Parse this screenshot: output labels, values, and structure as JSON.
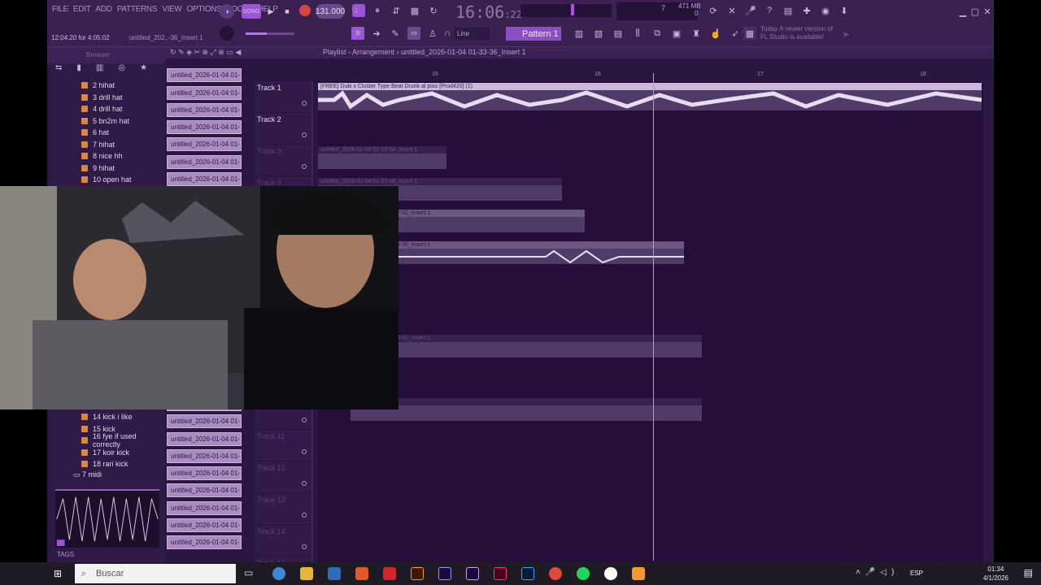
{
  "menu": [
    "FILE",
    "EDIT",
    "ADD",
    "PATTERNS",
    "VIEW",
    "OPTIONS",
    "TOOLS",
    "HELP"
  ],
  "hint": {
    "time_left": "12:04:20 for 4:05:02",
    "file_short": "untitled_202..-36_Insert 1"
  },
  "transport": {
    "tempo": "131.000",
    "clock_main": "16:06",
    "clock_sub": ":22",
    "mem_line1": "471 MB",
    "mem_line2": "0",
    "cpu": "7"
  },
  "snap": {
    "mode": "Line"
  },
  "pattern": {
    "label": "Pattern 1"
  },
  "news": {
    "line1": "Today  A newer version of",
    "line2": "FL Studio is available!"
  },
  "browser": {
    "title": "Browser",
    "items_top": [
      "2 hihat",
      "3 drill hat",
      "4 drill hat",
      "5 bn2m hat",
      "6 hat",
      "7 hihat",
      "8 nice hh",
      "9 hihat",
      "10 open hat"
    ],
    "items_bottom": [
      "14 kick i like",
      "15 kick",
      "16 fye if used correctly",
      "17 koir kick",
      "18 rari kick"
    ],
    "folder": "7 midi",
    "tags_label": "TAGS"
  },
  "channels": [
    "untitled_2026-01-04 01-",
    "untitled_2026-01-04 01-",
    "untitled_2026-01-04 01-",
    "untitled_2026-01-04 01-",
    "untitled_2026-01-04 01-",
    "untitled_2026-01-04 01-",
    "untitled_2026-01-04 01-",
    "untitled_2026-01-04 01-",
    "untitled_2026-01-04 01-",
    "untitled_2026-01-04 01-",
    "untitled_2026-01-04 01-",
    "untitled_2026-01-04 01-",
    "untitled_2026-01-04 01-",
    "untitled_2026-01-04 01-",
    "untitled_2026-01-04 01-",
    "untitled_2026-01-04 01-",
    "untitled_2026-01-04 01-",
    "untitled_2026-01-04 01-",
    "untitled_2026-01-04 01-",
    "untitled_2026-01-04 01-",
    "untitled_2026-01-04 01-",
    "untitled_2026-01-04 01-",
    "untitled_2026-01-04 01-",
    "untitled_2026-01-04 01-",
    "untitled_2026-01-04 01-",
    "untitled_2026-01-04 01-",
    "untitled_2026-01-04 01-",
    "untitled_2026-01-04 01-"
  ],
  "playlist": {
    "title": "Playlist - Arrangement",
    "file": "untitled_2026-01-04 01-33-36_Insert 1",
    "ruler": [
      "15",
      "16",
      "17",
      "18"
    ],
    "tracks": [
      "Track 1",
      "Track 2",
      "Track 3",
      "Track 4",
      "",
      "",
      "",
      "",
      "",
      "",
      "Track 10",
      "Track 11",
      "Track 12",
      "Track 13",
      "Track 14",
      "Track 15"
    ],
    "clips": [
      {
        "label": "[FREE] Duki x Cluster  Type Beat  Drunk al piso  [Prod420] (1)"
      },
      {
        "label": "untitled_2026-01-04 01-19-54_Insert 1"
      },
      {
        "label": "untitled_2026-01-04 01-27-06_Insert 1"
      },
      {
        "label": "27-32_Insert 1"
      },
      {
        "label": "33-36_Insert 1"
      },
      {
        "label": "24-58_Insert 1"
      },
      {
        "label": "24-58_Insert 1"
      }
    ]
  },
  "taskbar": {
    "search": "Buscar",
    "lang": "ESP",
    "time": "01:34",
    "date": "4/1/2026"
  }
}
